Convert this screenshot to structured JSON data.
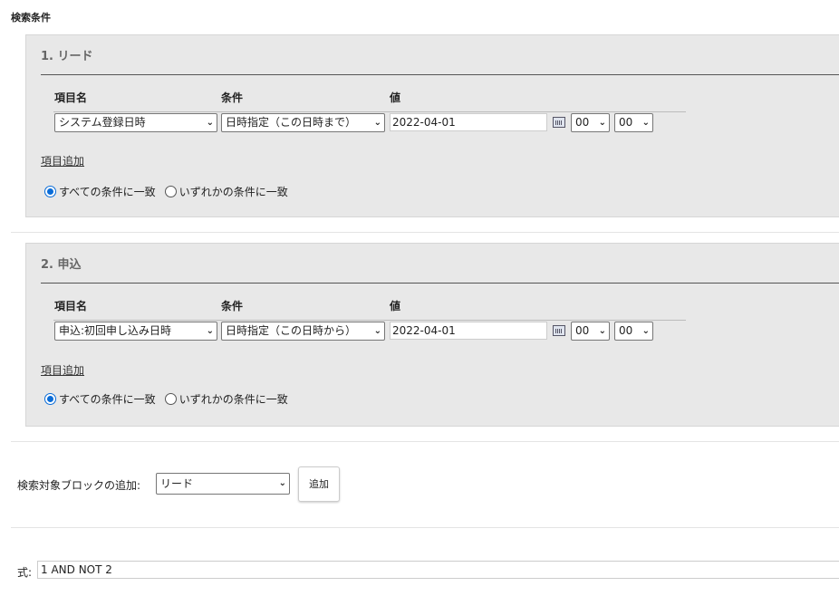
{
  "page": {
    "title": "検索条件"
  },
  "blocks": [
    {
      "title": "1. リード",
      "headers": {
        "item": "項目名",
        "condition": "条件",
        "value": "値"
      },
      "row": {
        "item": "システム登録日時",
        "condition": "日時指定（この日時まで）",
        "value": "2022-04-01",
        "hour": "00",
        "minute": "00"
      },
      "add_item": "項目追加",
      "match_all": "すべての条件に一致",
      "match_any": "いずれかの条件に一致",
      "selected_match": "all"
    },
    {
      "title": "2. 申込",
      "headers": {
        "item": "項目名",
        "condition": "条件",
        "value": "値"
      },
      "row": {
        "item": "申込:初回申し込み日時",
        "condition": "日時指定（この日時から）",
        "value": "2022-04-01",
        "hour": "00",
        "minute": "00"
      },
      "add_item": "項目追加",
      "match_all": "すべての条件に一致",
      "match_any": "いずれかの条件に一致",
      "selected_match": "all"
    }
  ],
  "add_block": {
    "label": "検索対象ブロックの追加:",
    "selected": "リード",
    "button": "追加"
  },
  "formula": {
    "label": "式:",
    "value": "1 AND NOT 2"
  },
  "colors": {
    "accent": "#0a6cd7",
    "panel": "#e8e8e8"
  }
}
